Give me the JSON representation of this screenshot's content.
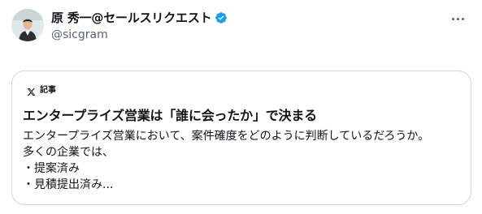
{
  "author": {
    "display_name": "原 秀一@セールスリクエスト",
    "handle": "@sicgram",
    "verified": true
  },
  "icons": {
    "avatar": "avatar",
    "verified": "verified-badge-icon",
    "more": "more-options-icon",
    "source": "x-logo-icon"
  },
  "colors": {
    "verified_blue": "#1d9bf0",
    "secondary_text": "#536471",
    "border": "#cfd9de"
  },
  "card": {
    "source_label": "記事",
    "title": "エンタープライズ営業は「誰に会ったか」で決まる",
    "body_lines": [
      "エンタープライズ営業において、案件確度をどのように判断しているだろうか。",
      "多くの企業では、",
      "・提案済み",
      "・見積提出済み..."
    ]
  }
}
